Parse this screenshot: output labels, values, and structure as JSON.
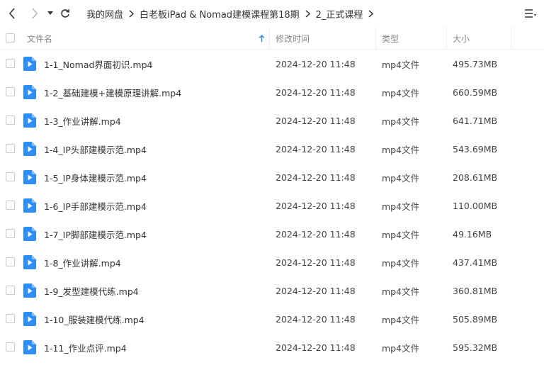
{
  "breadcrumb": {
    "items": [
      "我的网盘",
      "白老板iPad & Nomad建模课程第18期",
      "2_正式课程"
    ]
  },
  "header": {
    "name": "文件名",
    "modified": "修改时间",
    "type": "类型",
    "size": "大小",
    "sort_indicator": "arrow-up-icon"
  },
  "colors": {
    "icon_blue": "#2e8ef7",
    "sort_arrow": "#3a8dde",
    "header_text": "#888888"
  },
  "files": [
    {
      "name": "1-1_Nomad界面初识.mp4",
      "modified": "2024-12-20 11:48",
      "type": "mp4文件",
      "size": "495.73MB"
    },
    {
      "name": "1-2_基础建模+建模原理讲解.mp4",
      "modified": "2024-12-20 11:48",
      "type": "mp4文件",
      "size": "660.59MB"
    },
    {
      "name": "1-3_作业讲解.mp4",
      "modified": "2024-12-20 11:48",
      "type": "mp4文件",
      "size": "641.71MB"
    },
    {
      "name": "1-4_IP头部建模示范.mp4",
      "modified": "2024-12-20 11:48",
      "type": "mp4文件",
      "size": "543.69MB"
    },
    {
      "name": "1-5_IP身体建模示范.mp4",
      "modified": "2024-12-20 11:48",
      "type": "mp4文件",
      "size": "208.61MB"
    },
    {
      "name": "1-6_IP手部建模示范.mp4",
      "modified": "2024-12-20 11:48",
      "type": "mp4文件",
      "size": "110.00MB"
    },
    {
      "name": "1-7_IP脚部建模示范.mp4",
      "modified": "2024-12-20 11:48",
      "type": "mp4文件",
      "size": "49.16MB"
    },
    {
      "name": "1-8_作业讲解.mp4",
      "modified": "2024-12-20 11:48",
      "type": "mp4文件",
      "size": "437.41MB"
    },
    {
      "name": "1-9_发型建模代练.mp4",
      "modified": "2024-12-20 11:48",
      "type": "mp4文件",
      "size": "360.81MB"
    },
    {
      "name": "1-10_服装建模代练.mp4",
      "modified": "2024-12-20 11:48",
      "type": "mp4文件",
      "size": "505.89MB"
    },
    {
      "name": "1-11_作业点评.mp4",
      "modified": "2024-12-20 11:48",
      "type": "mp4文件",
      "size": "595.32MB"
    }
  ]
}
